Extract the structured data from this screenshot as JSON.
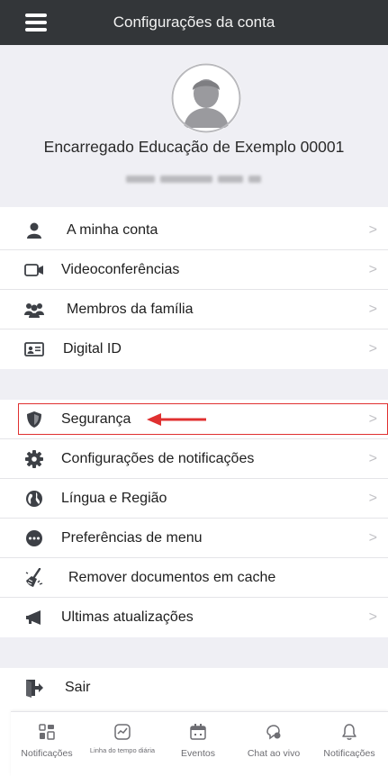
{
  "header": {
    "title": "Configurações da conta",
    "menu_icon": "hamburger-menu-icon"
  },
  "profile": {
    "name": "Encarregado Educação de Exemplo 00001",
    "avatar_icon": "user-avatar-icon"
  },
  "sections": [
    {
      "items": [
        {
          "label": "A minha conta",
          "icon": "person-icon"
        },
        {
          "label": "Videoconferências",
          "icon": "video-camera-icon"
        },
        {
          "label": "Membros da família",
          "icon": "family-group-icon"
        },
        {
          "label": "Digital ID",
          "icon": "id-card-icon"
        }
      ]
    },
    {
      "items": [
        {
          "label": "Segurança",
          "icon": "shield-icon"
        },
        {
          "label": "Configurações de notificações",
          "icon": "gear-icon"
        },
        {
          "label": "Língua e Região",
          "icon": "globe-icon"
        },
        {
          "label": "Preferências de menu",
          "icon": "ellipsis-circle-icon"
        },
        {
          "label": "Remover documentos em cache",
          "icon": "broom-icon"
        },
        {
          "label": "Ultimas atualizações",
          "icon": "megaphone-icon"
        }
      ]
    },
    {
      "items": [
        {
          "label": "Sair",
          "icon": "sign-out-icon"
        }
      ]
    }
  ],
  "chevron": ">",
  "tabbar": [
    {
      "label": "Notificações",
      "icon": "dashboard-grid-icon"
    },
    {
      "label": "Linha do tempo diária",
      "icon": "timeline-chart-icon"
    },
    {
      "label": "Eventos",
      "icon": "calendar-icon"
    },
    {
      "label": "Chat ao vivo",
      "icon": "chat-bubble-icon"
    },
    {
      "label": "Notificações",
      "icon": "bell-icon"
    }
  ],
  "colors": {
    "header_bg": "#333639",
    "page_bg": "#efeff4",
    "icon_dark": "#3d4046",
    "annotation_red": "#e03030"
  }
}
